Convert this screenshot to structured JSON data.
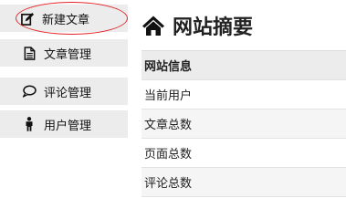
{
  "sidebar": {
    "items": [
      {
        "label": "新建文章",
        "icon": "edit-icon",
        "active": true
      },
      {
        "label": "文章管理",
        "icon": "document-icon"
      },
      {
        "label": "评论管理",
        "icon": "comment-icon"
      },
      {
        "label": "用户管理",
        "icon": "user-icon"
      }
    ],
    "highlight_color": "#e5252a"
  },
  "main": {
    "title": "网站摘要",
    "title_icon": "home-icon",
    "table": {
      "header": "网站信息",
      "rows": [
        "当前用户",
        "文章总数",
        "页面总数",
        "评论总数"
      ]
    }
  }
}
